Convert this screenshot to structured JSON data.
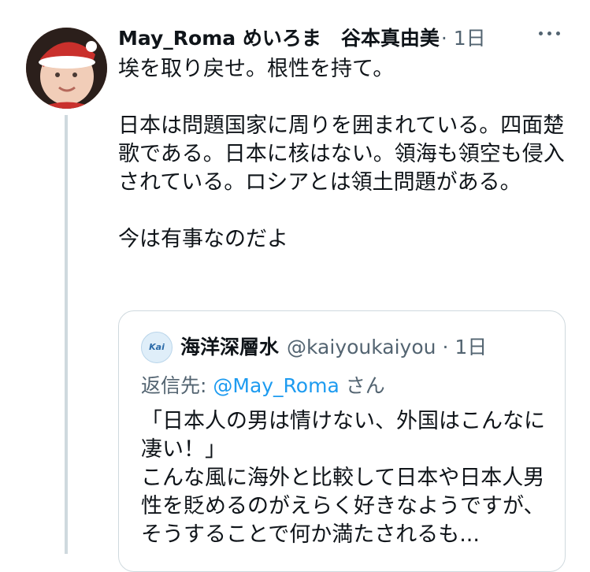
{
  "tweet": {
    "display_name": "May_Roma めいろま　谷本真由美",
    "time": "· 1日",
    "paragraphs": [
      "埃を取り戻せ。根性を持て。",
      "日本は問題国家に周りを囲まれている。四面楚歌である。日本に核はない。領海も領空も侵入されている。ロシアとは領土問題がある。",
      "今は有事なのだよ"
    ]
  },
  "quote": {
    "avatar_text": "Kai",
    "display_name": "海洋深層水",
    "handle_time": "@kaiyoukaiyou · 1日",
    "reply_prefix": "返信先: ",
    "reply_mention": "@May_Roma",
    "reply_suffix": " さん",
    "paragraphs": [
      "「日本人の男は情けない、外国はこんなに凄い！」",
      "こんな風に海外と比較して日本や日本人男性を貶めるのがえらく好きなようですが、そうすることで何か満たされるも..."
    ]
  },
  "icons": {
    "more": "more-options-icon",
    "avatar": "user-avatar",
    "quote_avatar": "quote-user-avatar"
  },
  "colors": {
    "text": "#0f1419",
    "secondary": "#536471",
    "link": "#1d9bf0",
    "border": "#cfd9de"
  }
}
